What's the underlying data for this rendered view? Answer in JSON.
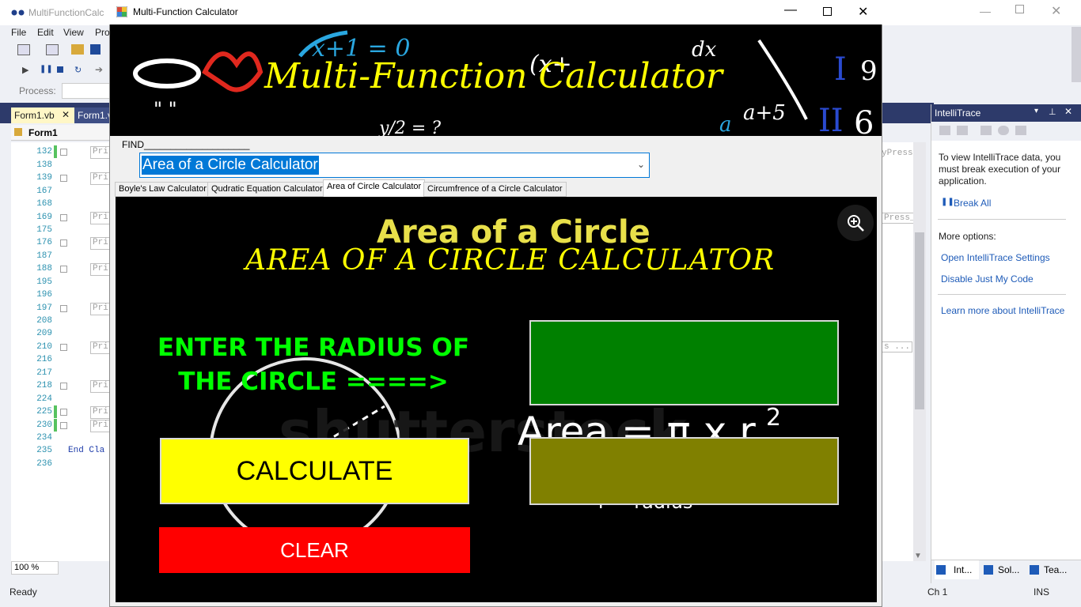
{
  "vs": {
    "title": "MultiFunctionCalc",
    "menu": [
      "File",
      "Edit",
      "View",
      "Pro"
    ],
    "process_label": "Process:",
    "tabs": [
      "Form1.vb",
      "Form1.v"
    ],
    "class_dropdown": "Form1",
    "line_numbers": [
      "132",
      "138",
      "139",
      "167",
      "168",
      "169",
      "175",
      "176",
      "187",
      "188",
      "195",
      "196",
      "197",
      "208",
      "209",
      "210",
      "216",
      "217",
      "218",
      "224",
      "225",
      "230",
      "234",
      "235",
      "236"
    ],
    "code_prefix": "Pri",
    "end_class": "End Cla",
    "right_snippets": [
      "yPress",
      "Press_",
      "s ..."
    ],
    "zoom": "100 %",
    "status_ready": "Ready",
    "status_ch": "Ch 1",
    "status_ins": "INS"
  },
  "intellitrace": {
    "title": "IntelliTrace",
    "message": "To view IntelliTrace data, you must break execution of your application.",
    "break_all": "Break All",
    "more_options": "More options:",
    "links": [
      "Open IntelliTrace Settings",
      "Disable Just My Code"
    ],
    "learn_more": "Learn more about IntelliTrace",
    "bottom_tabs": [
      "Int...",
      "Sol...",
      "Tea..."
    ]
  },
  "app": {
    "title": "Multi-Function Calculator",
    "banner_title": "Multi-Function Calculator",
    "find_label": "FIND____________________",
    "combo_value": "Area of a Circle Calculator",
    "tabs": [
      "Boyle's Law Calculator",
      "Qudratic Equation Calculator",
      "Area of Circle Calculator",
      "Circumfrence of a Circle Calculator"
    ],
    "active_tab": 2,
    "panel": {
      "bg_heading": "Area of a Circle",
      "heading": "AREA OF A CIRCLE CALCULATOR",
      "prompt": "ENTER THE RADIUS OF THE CIRCLE  ====>",
      "calculate_label": "CALCULATE",
      "clear_label": "CLEAR",
      "radius_value": "",
      "result_value": "",
      "formula_text": "Area = π x r",
      "formula_exp": "2",
      "radius_caption": "r = radius",
      "watermark": "shutterstock"
    }
  },
  "colors": {
    "yellow": "#ffff00",
    "green_text": "#00ff00",
    "input_green": "#008000",
    "output_olive": "#808000",
    "clear_red": "#ff0000",
    "heading_yellow": "#ffff00"
  }
}
